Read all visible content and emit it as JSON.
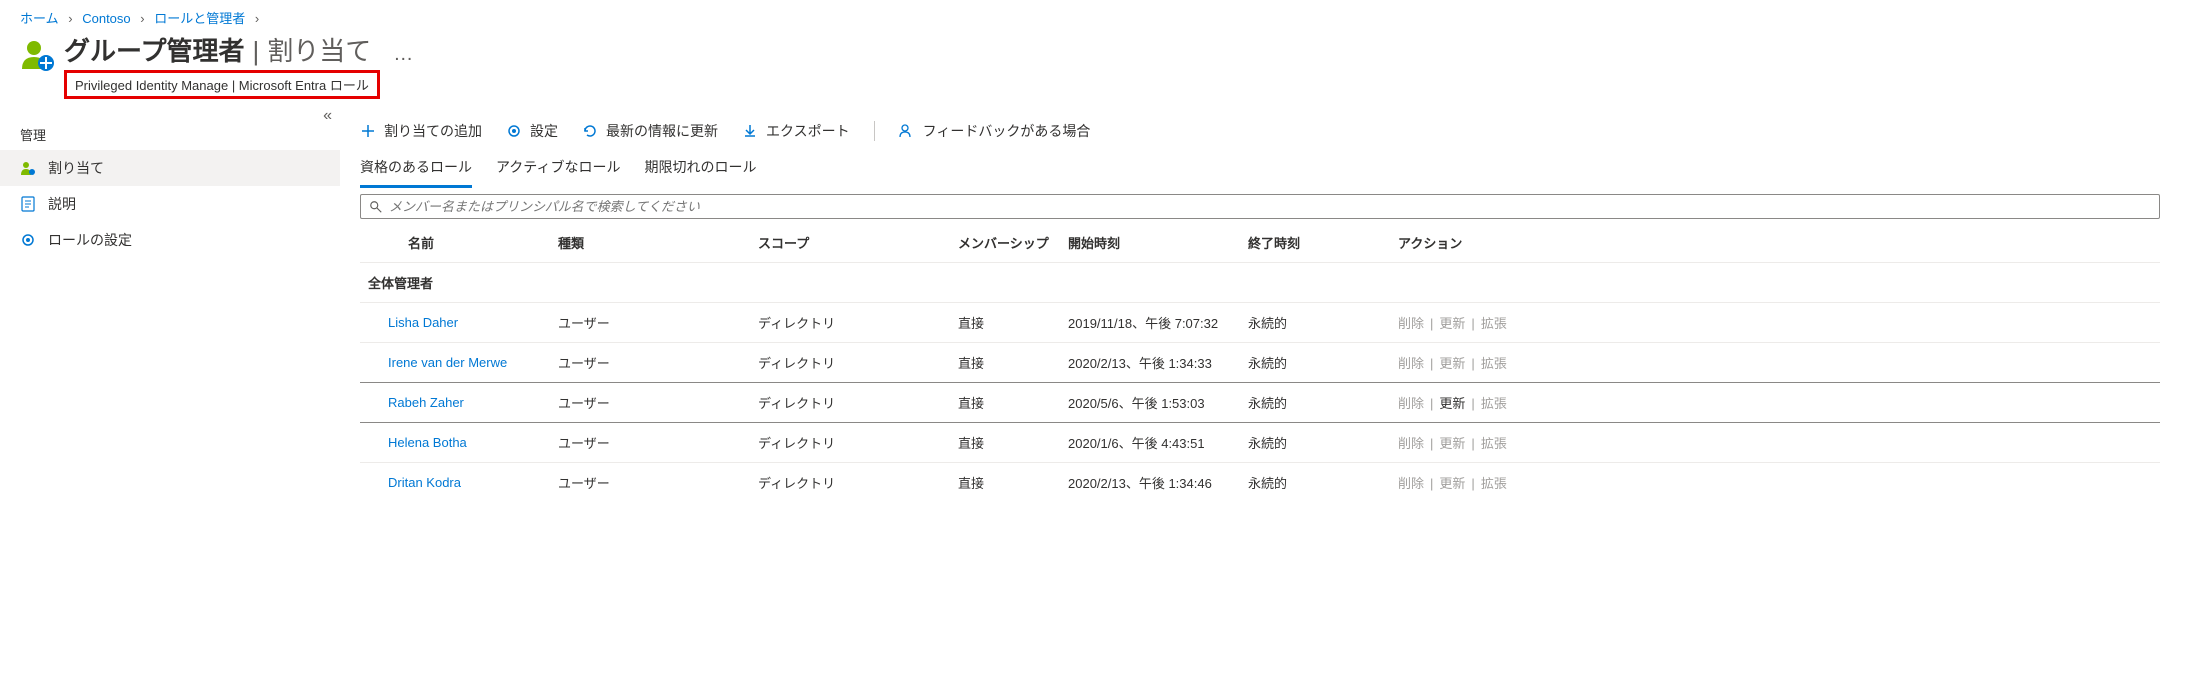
{
  "breadcrumb": [
    {
      "label": "ホーム"
    },
    {
      "label": "Contoso"
    },
    {
      "label": "ロールと管理者"
    }
  ],
  "header": {
    "title_main": "グループ管理者",
    "title_sep": " | ",
    "title_sub": "割り当て",
    "dots": "…",
    "subtitle": "Privileged Identity Manage | Microsoft Entra ロール"
  },
  "sidebar": {
    "section": "管理",
    "collapse": "«",
    "items": [
      {
        "label": "割り当て",
        "icon": "user"
      },
      {
        "label": "説明",
        "icon": "doc"
      },
      {
        "label": "ロールの設定",
        "icon": "gear"
      }
    ]
  },
  "toolbar": {
    "add": "割り当ての追加",
    "settings": "設定",
    "refresh": "最新の情報に更新",
    "export": "エクスポート",
    "feedback": "フィードバックがある場合"
  },
  "tabs": {
    "eligible": "資格のあるロール",
    "active": "アクティブなロール",
    "expired": "期限切れのロール"
  },
  "search": {
    "placeholder": "メンバー名またはプリンシパル名で検索してください"
  },
  "columns": {
    "name": "名前",
    "type": "種類",
    "scope": "スコープ",
    "membership": "メンバーシップ",
    "start": "開始時刻",
    "end": "終了時刻",
    "action": "アクション"
  },
  "group_label": "全体管理者",
  "rows": [
    {
      "name": "Lisha Daher",
      "type": "ユーザー",
      "scope": "ディレクトリ",
      "membership": "直接",
      "start": "2019/11/18、午後 7:07:32",
      "end": "永続的"
    },
    {
      "name": "Irene van der Merwe",
      "type": "ユーザー",
      "scope": "ディレクトリ",
      "membership": "直接",
      "start": "2020/2/13、午後 1:34:33",
      "end": "永続的"
    },
    {
      "name": "Rabeh Zaher",
      "type": "ユーザー",
      "scope": "ディレクトリ",
      "membership": "直接",
      "start": "2020/5/6、午後 1:53:03",
      "end": "永続的"
    },
    {
      "name": "Helena Botha",
      "type": "ユーザー",
      "scope": "ディレクトリ",
      "membership": "直接",
      "start": "2020/1/6、午後 4:43:51",
      "end": "永続的"
    },
    {
      "name": "Dritan Kodra",
      "type": "ユーザー",
      "scope": "ディレクトリ",
      "membership": "直接",
      "start": "2020/2/13、午後 1:34:46",
      "end": "永続的"
    }
  ],
  "actions": {
    "delete": "削除",
    "update": "更新",
    "extend": "拡張"
  }
}
